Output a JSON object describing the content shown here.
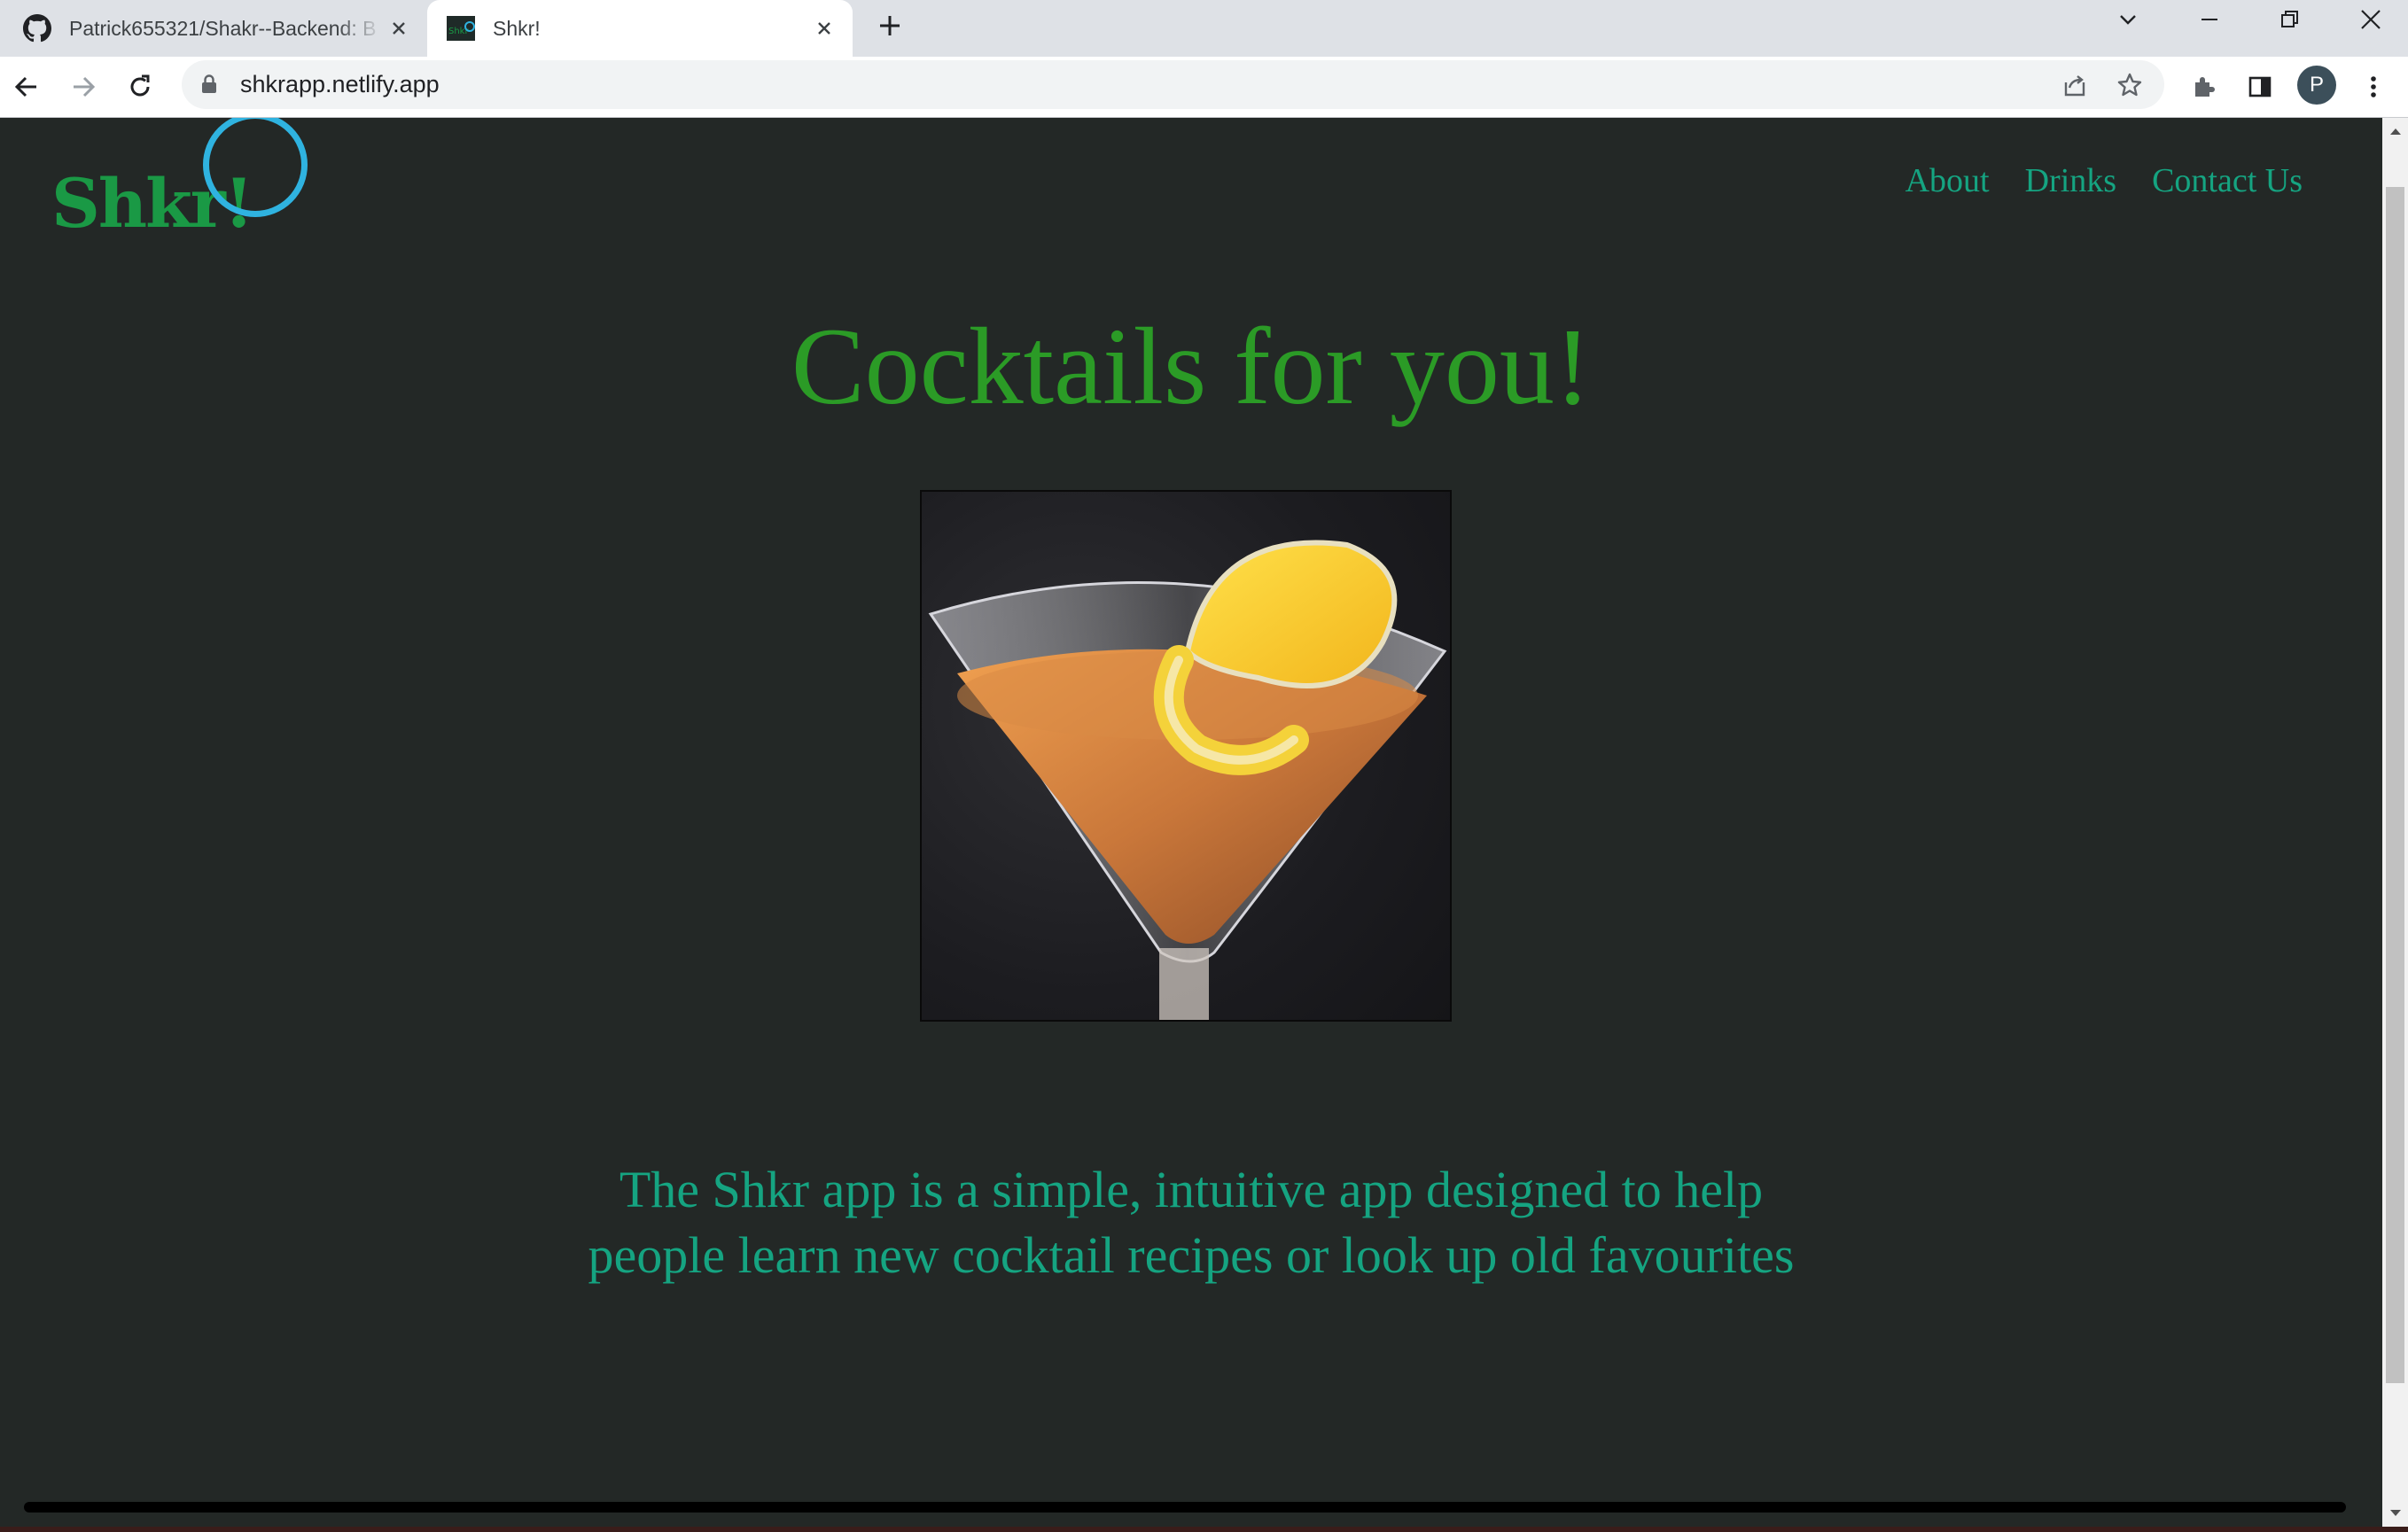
{
  "browser": {
    "tabs": [
      {
        "title": "Patrick655321/Shakr--Backend: B",
        "favicon": "github-icon",
        "active": false
      },
      {
        "title": "Shkr!",
        "favicon": "site-favicon",
        "active": true
      }
    ],
    "address": "shkrapp.netlify.app",
    "profile_initial": "P"
  },
  "page": {
    "logo": "Shkr!",
    "nav": [
      "About",
      "Drinks",
      "Contact Us"
    ],
    "headline": "Cocktails for you!",
    "hero_alt": "Martini glass cocktail with lemon twist",
    "tagline": "The Shkr app is a simple, intuitive app designed to help people learn new cocktail recipes or look up old favourites"
  },
  "colors": {
    "page_background": "#232826",
    "logo": "#1a9945",
    "headline": "#2b9b26",
    "nav_and_tagline": "#15a481",
    "cursor_highlight": "#2fb3e0"
  }
}
